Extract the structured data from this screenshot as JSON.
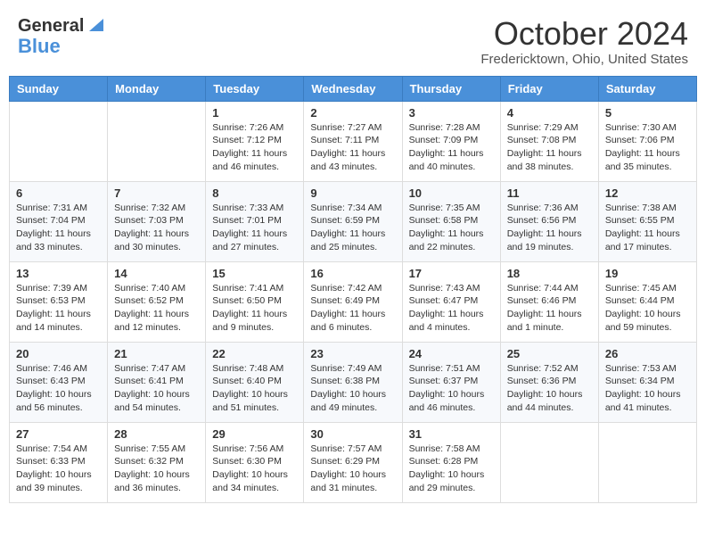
{
  "header": {
    "logo_line1": "General",
    "logo_line2": "Blue",
    "title": "October 2024",
    "subtitle": "Fredericktown, Ohio, United States"
  },
  "days_of_week": [
    "Sunday",
    "Monday",
    "Tuesday",
    "Wednesday",
    "Thursday",
    "Friday",
    "Saturday"
  ],
  "weeks": [
    [
      {
        "day": "",
        "info": ""
      },
      {
        "day": "",
        "info": ""
      },
      {
        "day": "1",
        "info": "Sunrise: 7:26 AM\nSunset: 7:12 PM\nDaylight: 11 hours and 46 minutes."
      },
      {
        "day": "2",
        "info": "Sunrise: 7:27 AM\nSunset: 7:11 PM\nDaylight: 11 hours and 43 minutes."
      },
      {
        "day": "3",
        "info": "Sunrise: 7:28 AM\nSunset: 7:09 PM\nDaylight: 11 hours and 40 minutes."
      },
      {
        "day": "4",
        "info": "Sunrise: 7:29 AM\nSunset: 7:08 PM\nDaylight: 11 hours and 38 minutes."
      },
      {
        "day": "5",
        "info": "Sunrise: 7:30 AM\nSunset: 7:06 PM\nDaylight: 11 hours and 35 minutes."
      }
    ],
    [
      {
        "day": "6",
        "info": "Sunrise: 7:31 AM\nSunset: 7:04 PM\nDaylight: 11 hours and 33 minutes."
      },
      {
        "day": "7",
        "info": "Sunrise: 7:32 AM\nSunset: 7:03 PM\nDaylight: 11 hours and 30 minutes."
      },
      {
        "day": "8",
        "info": "Sunrise: 7:33 AM\nSunset: 7:01 PM\nDaylight: 11 hours and 27 minutes."
      },
      {
        "day": "9",
        "info": "Sunrise: 7:34 AM\nSunset: 6:59 PM\nDaylight: 11 hours and 25 minutes."
      },
      {
        "day": "10",
        "info": "Sunrise: 7:35 AM\nSunset: 6:58 PM\nDaylight: 11 hours and 22 minutes."
      },
      {
        "day": "11",
        "info": "Sunrise: 7:36 AM\nSunset: 6:56 PM\nDaylight: 11 hours and 19 minutes."
      },
      {
        "day": "12",
        "info": "Sunrise: 7:38 AM\nSunset: 6:55 PM\nDaylight: 11 hours and 17 minutes."
      }
    ],
    [
      {
        "day": "13",
        "info": "Sunrise: 7:39 AM\nSunset: 6:53 PM\nDaylight: 11 hours and 14 minutes."
      },
      {
        "day": "14",
        "info": "Sunrise: 7:40 AM\nSunset: 6:52 PM\nDaylight: 11 hours and 12 minutes."
      },
      {
        "day": "15",
        "info": "Sunrise: 7:41 AM\nSunset: 6:50 PM\nDaylight: 11 hours and 9 minutes."
      },
      {
        "day": "16",
        "info": "Sunrise: 7:42 AM\nSunset: 6:49 PM\nDaylight: 11 hours and 6 minutes."
      },
      {
        "day": "17",
        "info": "Sunrise: 7:43 AM\nSunset: 6:47 PM\nDaylight: 11 hours and 4 minutes."
      },
      {
        "day": "18",
        "info": "Sunrise: 7:44 AM\nSunset: 6:46 PM\nDaylight: 11 hours and 1 minute."
      },
      {
        "day": "19",
        "info": "Sunrise: 7:45 AM\nSunset: 6:44 PM\nDaylight: 10 hours and 59 minutes."
      }
    ],
    [
      {
        "day": "20",
        "info": "Sunrise: 7:46 AM\nSunset: 6:43 PM\nDaylight: 10 hours and 56 minutes."
      },
      {
        "day": "21",
        "info": "Sunrise: 7:47 AM\nSunset: 6:41 PM\nDaylight: 10 hours and 54 minutes."
      },
      {
        "day": "22",
        "info": "Sunrise: 7:48 AM\nSunset: 6:40 PM\nDaylight: 10 hours and 51 minutes."
      },
      {
        "day": "23",
        "info": "Sunrise: 7:49 AM\nSunset: 6:38 PM\nDaylight: 10 hours and 49 minutes."
      },
      {
        "day": "24",
        "info": "Sunrise: 7:51 AM\nSunset: 6:37 PM\nDaylight: 10 hours and 46 minutes."
      },
      {
        "day": "25",
        "info": "Sunrise: 7:52 AM\nSunset: 6:36 PM\nDaylight: 10 hours and 44 minutes."
      },
      {
        "day": "26",
        "info": "Sunrise: 7:53 AM\nSunset: 6:34 PM\nDaylight: 10 hours and 41 minutes."
      }
    ],
    [
      {
        "day": "27",
        "info": "Sunrise: 7:54 AM\nSunset: 6:33 PM\nDaylight: 10 hours and 39 minutes."
      },
      {
        "day": "28",
        "info": "Sunrise: 7:55 AM\nSunset: 6:32 PM\nDaylight: 10 hours and 36 minutes."
      },
      {
        "day": "29",
        "info": "Sunrise: 7:56 AM\nSunset: 6:30 PM\nDaylight: 10 hours and 34 minutes."
      },
      {
        "day": "30",
        "info": "Sunrise: 7:57 AM\nSunset: 6:29 PM\nDaylight: 10 hours and 31 minutes."
      },
      {
        "day": "31",
        "info": "Sunrise: 7:58 AM\nSunset: 6:28 PM\nDaylight: 10 hours and 29 minutes."
      },
      {
        "day": "",
        "info": ""
      },
      {
        "day": "",
        "info": ""
      }
    ]
  ]
}
